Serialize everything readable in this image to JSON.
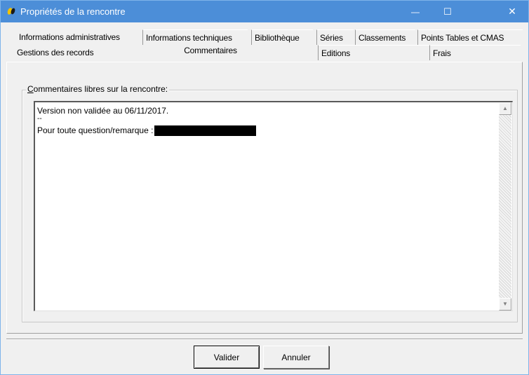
{
  "window": {
    "title": "Propriétés de la rencontre",
    "minimize_symbol": "—",
    "maximize_symbol": "☐",
    "close_symbol": "✕",
    "titlebar_color": "#4c8ed8"
  },
  "tabs_row1": [
    {
      "label": "Informations administratives"
    },
    {
      "label": "Informations techniques"
    },
    {
      "label": "Bibliothèque"
    },
    {
      "label": "Séries"
    },
    {
      "label": "Classements"
    },
    {
      "label": "Points Tables et CMAS"
    }
  ],
  "tabs_row2": [
    {
      "label": "Gestions des records"
    },
    {
      "label": "Commentaires",
      "active": true
    },
    {
      "label": "Editions"
    },
    {
      "label": "Frais"
    }
  ],
  "comments": {
    "group_label_first": "C",
    "group_label_rest": "ommentaires libres sur la rencontre:",
    "lines": [
      "Version non validée au 06/11/2017.",
      "--",
      "Pour toute question/remarque :"
    ],
    "redacted": true
  },
  "scrollbar": {
    "up_symbol": "▲",
    "down_symbol": "▼"
  },
  "buttons": {
    "ok": "Valider",
    "cancel": "Annuler"
  }
}
